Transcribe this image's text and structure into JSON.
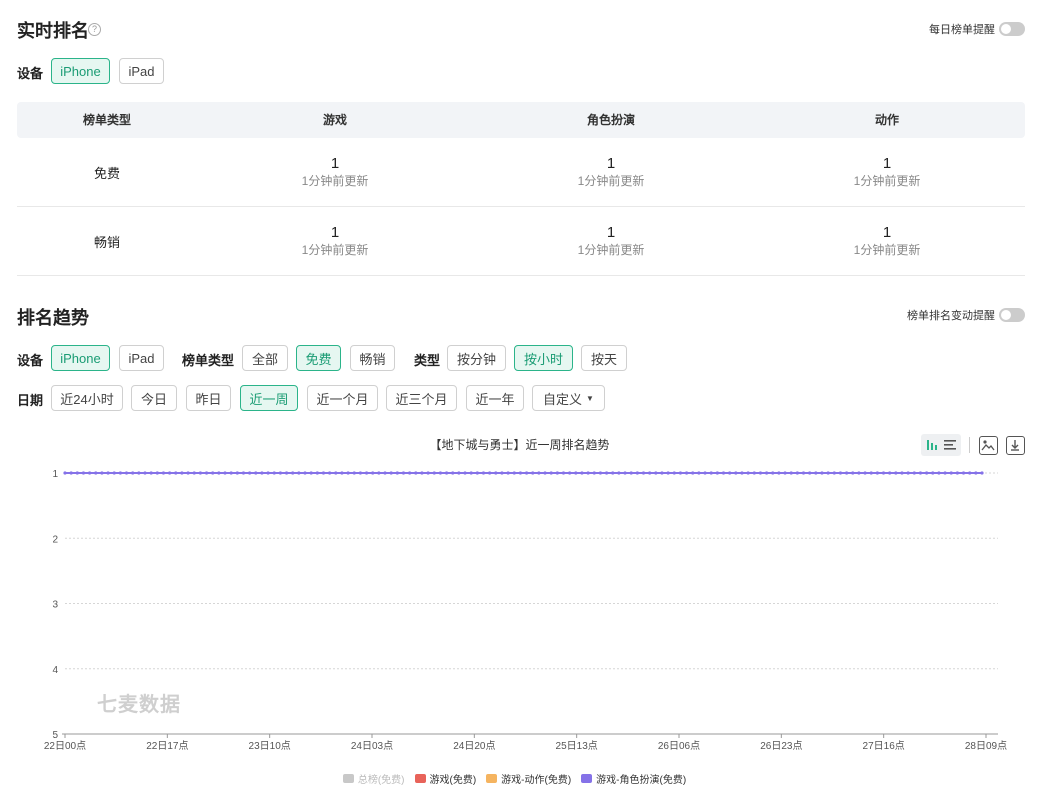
{
  "realtime": {
    "title": "实时排名",
    "help_icon": "help-icon",
    "reminder_label": "每日榜单提醒",
    "device_label": "设备",
    "devices": [
      "iPhone",
      "iPad"
    ],
    "table": {
      "headers": [
        "榜单类型",
        "游戏",
        "角色扮演",
        "动作"
      ],
      "rows": [
        {
          "name": "免费",
          "cells": [
            {
              "rank": "1",
              "updated": "1分钟前更新"
            },
            {
              "rank": "1",
              "updated": "1分钟前更新"
            },
            {
              "rank": "1",
              "updated": "1分钟前更新"
            }
          ]
        },
        {
          "name": "畅销",
          "cells": [
            {
              "rank": "1",
              "updated": "1分钟前更新"
            },
            {
              "rank": "1",
              "updated": "1分钟前更新"
            },
            {
              "rank": "1",
              "updated": "1分钟前更新"
            }
          ]
        }
      ]
    }
  },
  "trend": {
    "title": "排名趋势",
    "reminder_label": "榜单排名变动提醒",
    "device_label": "设备",
    "devices": [
      "iPhone",
      "iPad"
    ],
    "list_type_label": "榜单类型",
    "list_types": [
      "全部",
      "免费",
      "畅销"
    ],
    "type_label": "类型",
    "types": [
      "按分钟",
      "按小时",
      "按天"
    ],
    "date_label": "日期",
    "dates": [
      "近24小时",
      "今日",
      "昨日",
      "近一周",
      "近一个月",
      "近三个月",
      "近一年",
      "自定义"
    ]
  },
  "chart_data": {
    "type": "line",
    "title": "【地下城与勇士】近一周排名趋势",
    "x_ticks": [
      "22日00点",
      "22日17点",
      "23日10点",
      "24日03点",
      "24日20点",
      "25日13点",
      "26日06点",
      "26日23点",
      "27日16点",
      "28日09点"
    ],
    "y_ticks": [
      "1",
      "2",
      "3",
      "4",
      "5"
    ],
    "ylim": [
      1,
      5
    ],
    "y_inverted": true,
    "grid": true,
    "watermark": "七麦数据",
    "legend": [
      {
        "name": "总榜(免费)",
        "color": "#c8c8c8",
        "active": false
      },
      {
        "name": "游戏(免费)",
        "color": "#e8635a",
        "active": true
      },
      {
        "name": "游戏-动作(免费)",
        "color": "#f5b460",
        "active": true
      },
      {
        "name": "游戏-角色扮演(免费)",
        "color": "#8572e8",
        "active": true
      }
    ],
    "series": [
      {
        "name": "游戏-角色扮演(免费)",
        "color": "#8572e8",
        "value": 1,
        "points": 150
      }
    ]
  }
}
